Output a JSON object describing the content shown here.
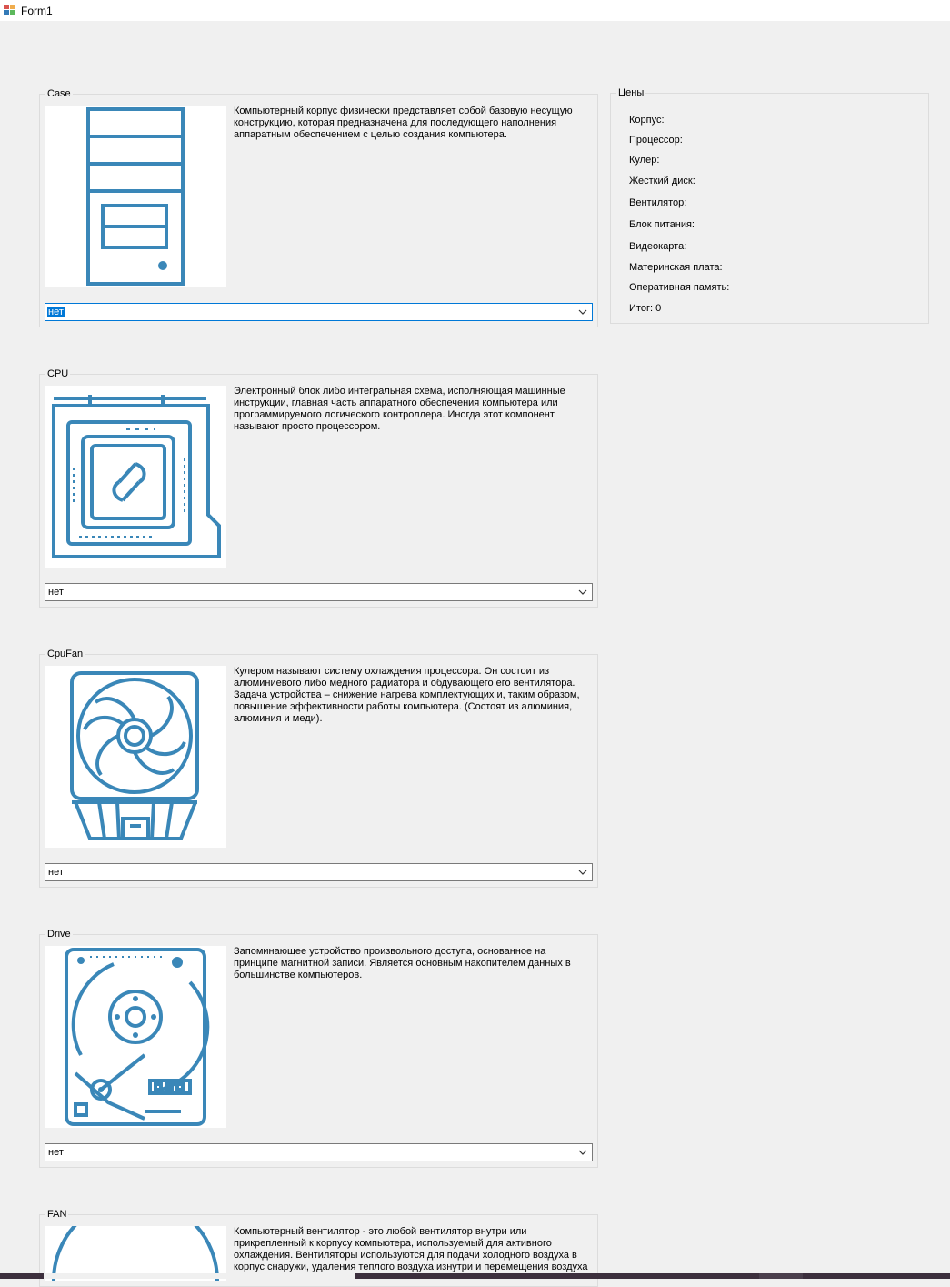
{
  "window": {
    "title": "Form1"
  },
  "components": [
    {
      "key": "case",
      "group_label": "Case",
      "description": "Компьютерный корпус физически представляет собой базовую несущую конструкцию, которая предназначена для последующего наполнения аппаратным обеспечением с целью создания компьютера.",
      "selected": "нет",
      "icon": "pc-case-icon"
    },
    {
      "key": "cpu",
      "group_label": "CPU",
      "description": "Электронный блок либо интегральная схема, исполняющая машинные инструкции, главная часть аппаратного обеспечения компьютера или программируемого логического контроллера. Иногда этот компонент называют просто процессором.",
      "selected": "нет",
      "icon": "cpu-icon"
    },
    {
      "key": "cpufan",
      "group_label": "CpuFan",
      "description": "Кулером называют систему охлаждения процессора. Он состоит из алюминиевого либо медного радиатора и обдувающего его вентилятора. Задача устройства – снижение нагрева комплектующих и, таким образом, повышение эффективности работы компьютера. (Состоят из алюминия, алюминия и меди).",
      "selected": "нет",
      "icon": "cpu-cooler-icon"
    },
    {
      "key": "drive",
      "group_label": "Drive",
      "description": "Запоминающее устройство произвольного доступа, основанное на принципе магнитной записи. Является основным накопителем данных в большинстве компьютеров.",
      "selected": "нет",
      "icon": "hard-drive-icon"
    },
    {
      "key": "fan",
      "group_label": "FAN",
      "description": "Компьютерный вентилятор - это любой вентилятор внутри или прикрепленный к корпусу компьютера, используемый для активного охлаждения. Вентиляторы используются для подачи холодного воздуха в корпус снаружи, удаления теплого воздуха изнутри и перемещения воздуха",
      "icon": "case-fan-icon"
    }
  ],
  "prices": {
    "group_label": "Цены",
    "rows": [
      "Корпус:",
      "Процессор:",
      "Кулер:",
      "Жесткий диск:",
      "Вентилятор:",
      "Блок питания:",
      "Видеокарта:",
      "Материнская плата:",
      "Оперативная память:",
      "Итог: 0"
    ]
  },
  "colors": {
    "icon_stroke": "#3a87b8",
    "focus_blue": "#0078d7",
    "form_bg": "#f0f0f0"
  }
}
